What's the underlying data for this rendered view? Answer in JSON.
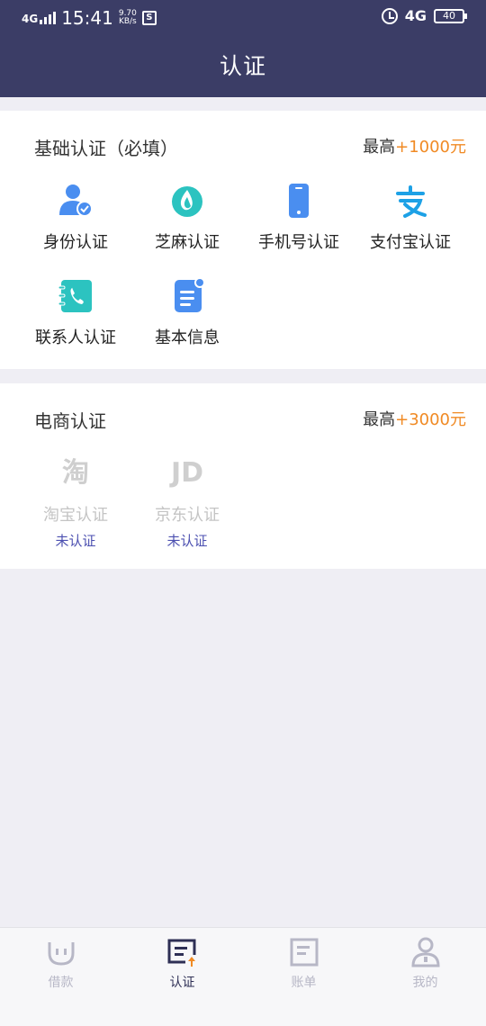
{
  "status_bar": {
    "time": "15:41",
    "signal": "4G",
    "speed_value": "9.70",
    "speed_unit": "KB/s",
    "network": "4G",
    "battery": "40"
  },
  "header": {
    "title": "认证"
  },
  "basic_section": {
    "title": "基础认证（必填）",
    "max_label": "最高",
    "max_amount": "+1000元",
    "items": [
      {
        "label": "身份认证",
        "icon": "identity-icon"
      },
      {
        "label": "芝麻认证",
        "icon": "sesame-icon"
      },
      {
        "label": "手机号认证",
        "icon": "phone-icon"
      },
      {
        "label": "支付宝认证",
        "icon": "alipay-icon"
      },
      {
        "label": "联系人认证",
        "icon": "contacts-icon"
      },
      {
        "label": "基本信息",
        "icon": "document-icon"
      }
    ]
  },
  "ecommerce_section": {
    "title": "电商认证",
    "max_label": "最高",
    "max_amount": "+3000元",
    "items": [
      {
        "label": "淘宝认证",
        "status": "未认证",
        "logo_text": "淘",
        "icon": "taobao-icon"
      },
      {
        "label": "京东认证",
        "status": "未认证",
        "logo_text": "JD",
        "icon": "jd-icon"
      }
    ]
  },
  "tabbar": {
    "tabs": [
      {
        "label": "借款",
        "icon": "loan-icon",
        "active": false
      },
      {
        "label": "认证",
        "icon": "certify-icon",
        "active": true
      },
      {
        "label": "账单",
        "icon": "bill-icon",
        "active": false
      },
      {
        "label": "我的",
        "icon": "profile-icon",
        "active": false
      }
    ]
  },
  "colors": {
    "header_bg": "#3b3d66",
    "accent_orange": "#f08a24",
    "blue": "#4a8ef0",
    "teal": "#2cc3c0",
    "status_link": "#4b4fb0",
    "page_bg": "#efeef4"
  }
}
